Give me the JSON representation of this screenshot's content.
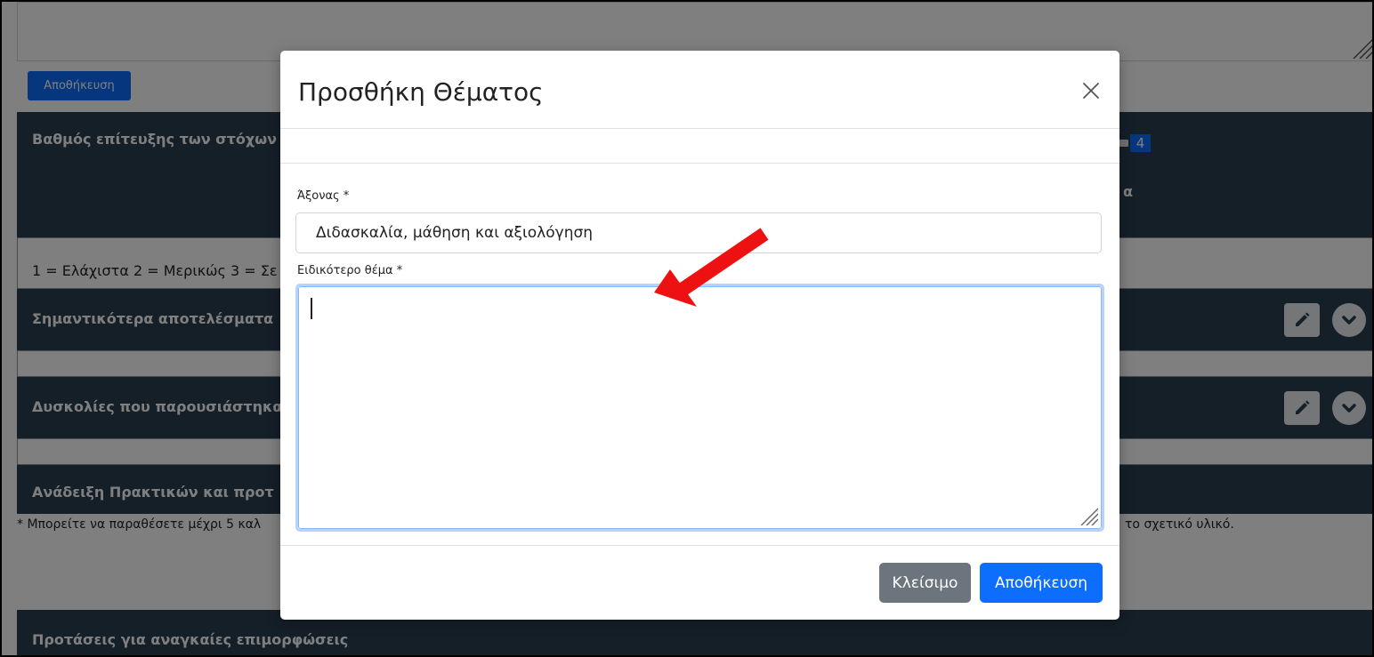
{
  "background": {
    "save_button_label": "Αποθήκευση",
    "panels": {
      "goals_title": "Βαθμός επίτευξης των στόχων",
      "goals_side_fragment": "α",
      "goals_slider_value": "4",
      "scale_text": "1 = Ελάχιστα 2 = Μερικώς 3 = Σε",
      "results_title": "Σημαντικότερα αποτελέσματα",
      "difficulties_title": "Δυσκολίες που παρουσιάστηκα",
      "practices_title": "Ανάδειξη Πρακτικών και προτ",
      "note_left": "* Μπορείτε να παραθέσετε μέχρι 5 καλ",
      "note_right": "το σχετικό υλικό.",
      "training_title": "Προτάσεις για αναγκαίες επιμορφώσεις"
    }
  },
  "modal": {
    "title": "Προσθήκη Θέματος",
    "axis_label": "Άξονας *",
    "axis_value": "Διδασκαλία, μάθηση και αξιολόγηση",
    "topic_label": "Ειδικότερο θέμα *",
    "topic_value": "",
    "close_button": "Κλείσιμο",
    "save_button": "Αποθήκευση"
  },
  "colors": {
    "panel": "#2b3e50",
    "primary": "#0d6efd",
    "secondary": "#6c757d",
    "annotation_arrow": "#ee1111"
  },
  "icons": [
    "close-icon",
    "pencil-icon",
    "chevron-down-icon",
    "resize-grip-icon",
    "arrow-annotation"
  ]
}
